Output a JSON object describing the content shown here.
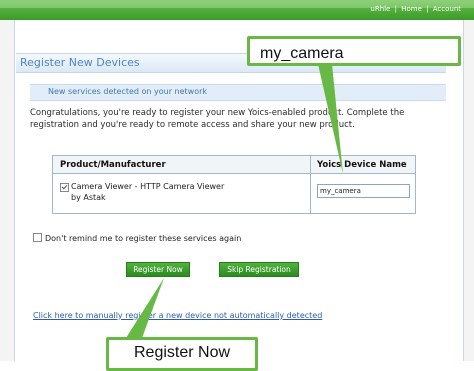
{
  "topbar": {
    "links": [
      "uRhle",
      "Home",
      "Account"
    ],
    "separator": "|"
  },
  "page": {
    "title": "Register New Devices",
    "subheading": "New services detected on your network",
    "intro": "Congratulations, you're ready to register your new Yoics-enabled product. Complete the registration and you're ready to remote access and share your new product."
  },
  "table": {
    "headers": [
      "Product/Manufacturer",
      "Yoics Device Name"
    ],
    "rows": [
      {
        "checked": true,
        "product": "Camera Viewer - HTTP Camera Viewer",
        "manufacturer": "by Astak",
        "device_name": "my_camera"
      }
    ]
  },
  "remind_checkbox": {
    "checked": false,
    "label": "Don't remind me to register these services again"
  },
  "buttons": {
    "register": "Register Now",
    "skip": "Skip Registration"
  },
  "manual_link": "Click here to manually register a new device not automatically detected",
  "callouts": {
    "top": "my_camera",
    "bottom": "Register Now"
  },
  "colors": {
    "accent_green": "#4fb43a",
    "callout_border": "#68b845",
    "title_blue": "#4f86be",
    "link_blue": "#2a5db0"
  }
}
